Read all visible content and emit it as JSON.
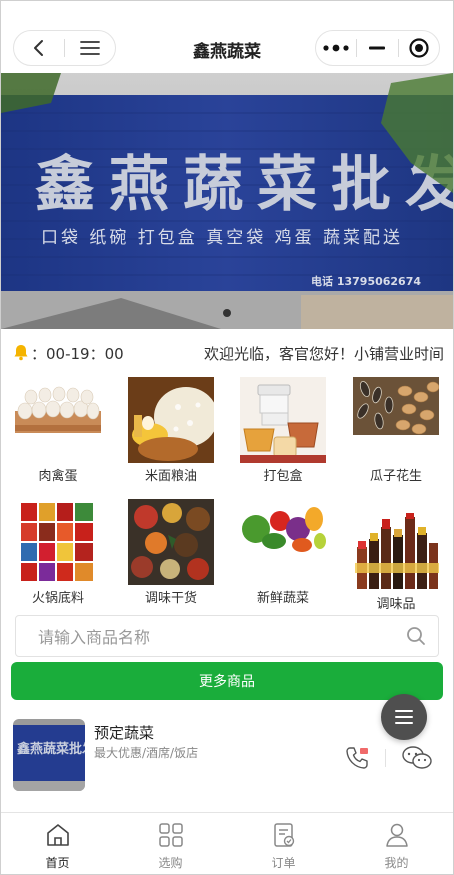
{
  "header": {
    "title": "鑫燕蔬菜",
    "back_icon": "chevron-left-icon",
    "menu_icon": "hamburger-menu-icon",
    "more_icon": "more-dots-icon",
    "minimize_icon": "minimize-icon",
    "close_icon": "target-close-icon"
  },
  "banner": {
    "sign_text": "鑫燕蔬菜批发",
    "sign_subtext": "口袋 纸碗 打包盒 真空袋 鸡蛋 蔬菜配送",
    "phone_text": "电话 13795062674",
    "active_slide": 1,
    "colors": {
      "sign_blue": "#233c8f",
      "sign_text": "#cfd4e0"
    }
  },
  "notice": {
    "bell_icon": "bell-icon",
    "hours": "：00-19：00",
    "marquee": "欢迎光临，客官您好！小铺营业时间"
  },
  "categories": [
    {
      "label": "肉禽蛋",
      "image": "eggs-image"
    },
    {
      "label": "米面粮油",
      "image": "rice-flour-oil-image"
    },
    {
      "label": "打包盒",
      "image": "takeout-box-image"
    },
    {
      "label": "瓜子花生",
      "image": "seeds-peanuts-image"
    },
    {
      "label": "火锅底料",
      "image": "hotpot-base-image"
    },
    {
      "label": "调味干货",
      "image": "dry-spices-image"
    },
    {
      "label": "新鲜蔬菜",
      "image": "fresh-vegetables-image"
    },
    {
      "label": "调味品",
      "image": "condiments-image"
    }
  ],
  "search": {
    "placeholder": "请输入商品名称",
    "icon": "search-icon"
  },
  "more_button": {
    "label": "更多商品",
    "color": "#1aad3b"
  },
  "fab": {
    "icon": "menu-icon"
  },
  "store": {
    "name": "预定蔬菜",
    "desc": "最大优惠/酒席/饭店",
    "thumb_sign": "鑫燕蔬菜批发",
    "phone_icon": "phone-icon",
    "wechat_icon": "wechat-icon"
  },
  "tabbar": {
    "items": [
      {
        "label": "首页",
        "icon": "home-icon",
        "active": true
      },
      {
        "label": "选购",
        "icon": "grid-icon",
        "active": false
      },
      {
        "label": "订单",
        "icon": "order-icon",
        "active": false
      },
      {
        "label": "我的",
        "icon": "user-icon",
        "active": false
      }
    ]
  }
}
